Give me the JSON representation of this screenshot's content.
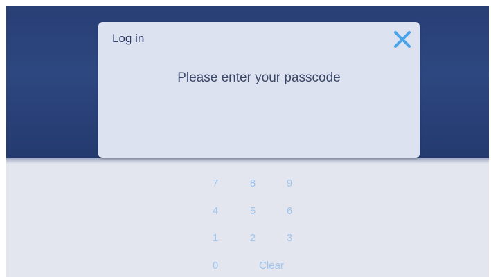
{
  "dialog": {
    "title": "Log in",
    "message": "Please enter your passcode",
    "close_icon": "close-icon",
    "close_color": "#4aa3e6"
  },
  "keypad": {
    "key_7": "7",
    "key_8": "8",
    "key_9": "9",
    "key_4": "4",
    "key_5": "5",
    "key_6": "6",
    "key_1": "1",
    "key_2": "2",
    "key_3": "3",
    "key_0": "0",
    "clear": "Clear",
    "key_color": "#9fc6ee"
  },
  "colors": {
    "background_top": "#2d4780",
    "keypad_background": "#e3e6ef",
    "dialog_background": "#dde2f1"
  }
}
